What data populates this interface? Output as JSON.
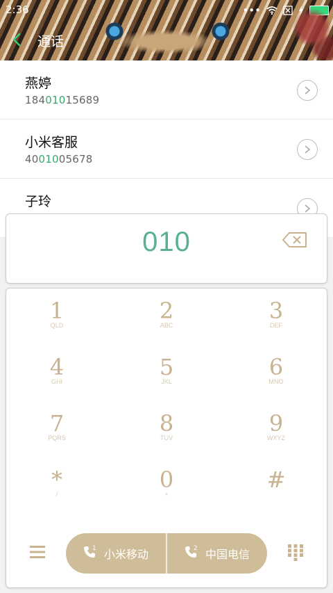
{
  "status": {
    "time": "2:36"
  },
  "titlebar": {
    "title": "通话"
  },
  "contacts": [
    {
      "name": "燕婷",
      "num_pre": "184",
      "num_hl": "010",
      "num_post": "15689"
    },
    {
      "name": "小米客服",
      "num_pre": "40",
      "num_hl": "010",
      "num_post": "05678"
    },
    {
      "name": "子玲",
      "num_pre": "",
      "num_hl": "",
      "num_post": ""
    }
  ],
  "display": {
    "digits": "010"
  },
  "keys": [
    {
      "digit": "1",
      "letters": "QLD"
    },
    {
      "digit": "2",
      "letters": "ABC"
    },
    {
      "digit": "3",
      "letters": "DEF"
    },
    {
      "digit": "4",
      "letters": "GHI"
    },
    {
      "digit": "5",
      "letters": "JKL"
    },
    {
      "digit": "6",
      "letters": "MNO"
    },
    {
      "digit": "7",
      "letters": "PQRS"
    },
    {
      "digit": "8",
      "letters": "TUV"
    },
    {
      "digit": "9",
      "letters": "WXYZ"
    },
    {
      "digit": "*",
      "letters": "/"
    },
    {
      "digit": "0",
      "letters": "+"
    },
    {
      "digit": "#",
      "letters": ""
    }
  ],
  "dial": {
    "sim1": {
      "number": "1",
      "label": "小米移动"
    },
    "sim2": {
      "number": "2",
      "label": "中国电信"
    }
  },
  "colors": {
    "accent": "#5ab08f",
    "dial_bg": "#cfbc98",
    "key_text": "#c9b28f"
  }
}
